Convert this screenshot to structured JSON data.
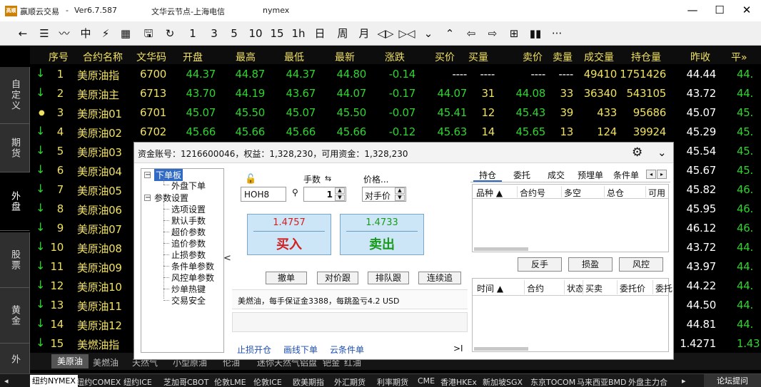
{
  "titlebar": {
    "logo": "高顺",
    "app_name": "赢顺云交易",
    "version": "Ver6.7.587",
    "server": "文华云节点-上海电信",
    "user": "nymex",
    "minimize": "—",
    "maximize": "☐",
    "close": "✕"
  },
  "toolbar": {
    "icons": [
      {
        "name": "back-icon",
        "glyph": "←"
      },
      {
        "name": "list-icon",
        "glyph": "☰"
      },
      {
        "name": "chart-line-icon",
        "glyph": "〰"
      },
      {
        "name": "kline-icon",
        "glyph": "中"
      },
      {
        "name": "flash-icon",
        "glyph": "⚡"
      },
      {
        "name": "grid-icon",
        "glyph": "▦"
      },
      {
        "name": "save-icon",
        "glyph": "🖫"
      },
      {
        "name": "refresh-icon",
        "glyph": "↻"
      },
      {
        "name": "period-1",
        "glyph": "1"
      },
      {
        "name": "period-3",
        "glyph": "3"
      },
      {
        "name": "period-5",
        "glyph": "5"
      },
      {
        "name": "period-10",
        "glyph": "10"
      },
      {
        "name": "period-15",
        "glyph": "15"
      },
      {
        "name": "period-1h",
        "glyph": "1h"
      },
      {
        "name": "period-day",
        "glyph": "日"
      },
      {
        "name": "period-week",
        "glyph": "周"
      },
      {
        "name": "period-month",
        "glyph": "月"
      },
      {
        "name": "zoom-in-icon",
        "glyph": "◁▷"
      },
      {
        "name": "zoom-out-icon",
        "glyph": "▷◁"
      },
      {
        "name": "chevron-down-icon",
        "glyph": "⌄"
      },
      {
        "name": "chevron-up-icon",
        "glyph": "⌃"
      },
      {
        "name": "prev-icon",
        "glyph": "⇦"
      },
      {
        "name": "next-icon",
        "glyph": "⇨"
      },
      {
        "name": "layout-icon",
        "glyph": "⊞"
      },
      {
        "name": "bars-icon",
        "glyph": "▮▮"
      },
      {
        "name": "more-icon",
        "glyph": "···"
      }
    ]
  },
  "sidetabs": [
    {
      "label": "自定义",
      "active": false
    },
    {
      "label": "期货",
      "active": false
    },
    {
      "label": "外盘",
      "active": true
    },
    {
      "label": "股票",
      "active": false
    },
    {
      "label": "黄金",
      "active": false
    },
    {
      "label": "外",
      "active": false
    }
  ],
  "table": {
    "headers": [
      "序号",
      "合约名称",
      "文华码",
      "开盘",
      "最高",
      "最低",
      "最新",
      "涨跌",
      "买价",
      "买量",
      "卖价",
      "卖量",
      "成交量",
      "持仓量",
      "昨收",
      "平均"
    ],
    "header_more": "平»",
    "rows": [
      {
        "trend": "down",
        "no": "1",
        "name": "美原油指",
        "code": "6700",
        "open": "44.37",
        "high": "44.87",
        "low": "44.37",
        "last": "44.80",
        "chg": "-0.14",
        "bid": "----",
        "bidv": "----",
        "ask": "----",
        "askv": "----",
        "vol": "49410",
        "oi": "1751426",
        "prev": "44.44",
        "avg": "44."
      },
      {
        "trend": "down",
        "no": "2",
        "name": "美原油主",
        "code": "6713",
        "open": "43.70",
        "high": "44.19",
        "low": "43.67",
        "last": "44.07",
        "chg": "-0.17",
        "bid": "44.07",
        "bidv": "31",
        "ask": "44.08",
        "askv": "33",
        "vol": "36340",
        "oi": "543105",
        "prev": "43.72",
        "avg": "44."
      },
      {
        "trend": "flat",
        "no": "3",
        "name": "美原油01",
        "code": "6701",
        "open": "45.07",
        "high": "45.50",
        "low": "45.07",
        "last": "45.50",
        "chg": "-0.07",
        "bid": "45.41",
        "bidv": "12",
        "ask": "45.43",
        "askv": "39",
        "vol": "433",
        "oi": "95686",
        "prev": "45.07",
        "avg": "45."
      },
      {
        "trend": "down",
        "no": "4",
        "name": "美原油02",
        "code": "6702",
        "open": "45.66",
        "high": "45.66",
        "low": "45.66",
        "last": "45.66",
        "chg": "-0.12",
        "bid": "45.63",
        "bidv": "14",
        "ask": "45.65",
        "askv": "13",
        "vol": "124",
        "oi": "39924",
        "prev": "45.29",
        "avg": "45."
      },
      {
        "trend": "down",
        "no": "5",
        "name": "美原油03",
        "code": "",
        "open": "",
        "high": "",
        "low": "",
        "last": "",
        "chg": "",
        "bid": "",
        "bidv": "",
        "ask": "",
        "askv": "",
        "vol": "",
        "oi": "",
        "prev": "45.54",
        "avg": "45."
      },
      {
        "trend": "down",
        "no": "6",
        "name": "美原油04",
        "code": "",
        "open": "",
        "high": "",
        "low": "",
        "last": "",
        "chg": "",
        "bid": "",
        "bidv": "",
        "ask": "",
        "askv": "",
        "vol": "",
        "oi": "",
        "prev": "45.67",
        "avg": "45."
      },
      {
        "trend": "down",
        "no": "7",
        "name": "美原油05",
        "code": "",
        "open": "",
        "high": "",
        "low": "",
        "last": "",
        "chg": "",
        "bid": "",
        "bidv": "",
        "ask": "",
        "askv": "",
        "vol": "",
        "oi": "",
        "prev": "45.82",
        "avg": "46."
      },
      {
        "trend": "down",
        "no": "8",
        "name": "美原油06",
        "code": "",
        "open": "",
        "high": "",
        "low": "",
        "last": "",
        "chg": "",
        "bid": "",
        "bidv": "",
        "ask": "",
        "askv": "",
        "vol": "",
        "oi": "",
        "prev": "45.95",
        "avg": "46."
      },
      {
        "trend": "down",
        "no": "9",
        "name": "美原油07",
        "code": "",
        "open": "",
        "high": "",
        "low": "",
        "last": "",
        "chg": "",
        "bid": "",
        "bidv": "",
        "ask": "",
        "askv": "",
        "vol": "",
        "oi": "",
        "prev": "46.12",
        "avg": "46."
      },
      {
        "trend": "down",
        "no": "10",
        "name": "美原油08",
        "code": "",
        "open": "",
        "high": "",
        "low": "",
        "last": "",
        "chg": "",
        "bid": "",
        "bidv": "",
        "ask": "",
        "askv": "",
        "vol": "",
        "oi": "",
        "prev": "43.72",
        "avg": "44."
      },
      {
        "trend": "down",
        "no": "11",
        "name": "美原油09",
        "code": "",
        "open": "",
        "high": "",
        "low": "",
        "last": "",
        "chg": "",
        "bid": "",
        "bidv": "",
        "ask": "",
        "askv": "",
        "vol": "",
        "oi": "",
        "prev": "43.97",
        "avg": "44."
      },
      {
        "trend": "down",
        "no": "12",
        "name": "美原油10",
        "code": "",
        "open": "",
        "high": "",
        "low": "",
        "last": "",
        "chg": "",
        "bid": "",
        "bidv": "",
        "ask": "",
        "askv": "",
        "vol": "",
        "oi": "",
        "prev": "44.22",
        "avg": "44."
      },
      {
        "trend": "down",
        "no": "13",
        "name": "美原油11",
        "code": "",
        "open": "",
        "high": "",
        "low": "",
        "last": "",
        "chg": "",
        "bid": "",
        "bidv": "",
        "ask": "",
        "askv": "",
        "vol": "",
        "oi": "",
        "prev": "44.50",
        "avg": "44."
      },
      {
        "trend": "down",
        "no": "14",
        "name": "美原油12",
        "code": "",
        "open": "",
        "high": "",
        "low": "",
        "last": "",
        "chg": "",
        "bid": "",
        "bidv": "",
        "ask": "",
        "askv": "",
        "vol": "",
        "oi": "",
        "prev": "44.81",
        "avg": "44."
      },
      {
        "trend": "down",
        "no": "15",
        "name": "美燃油指",
        "code": "",
        "open": "",
        "high": "",
        "low": "",
        "last": "",
        "chg": "",
        "bid": "",
        "bidv": "",
        "ask": "",
        "askv": "",
        "vol": "",
        "oi": "",
        "prev": "1.4271",
        "avg": "1.43"
      }
    ]
  },
  "subtabs": [
    "美原油",
    "美燃油",
    "天然气",
    "小型原油",
    "伦油",
    "迷你天然气",
    "铝盘",
    "钯金",
    "红油"
  ],
  "bottombar": {
    "items": [
      "纽约NYMEX",
      "纽约COMEX",
      "纽约ICE",
      "芝加哥CBOT",
      "伦敦LME",
      "伦敦ICE",
      "欧美期指",
      "外汇期货",
      "利率期货",
      "CME",
      "香港HKEx",
      "新加坡SGX",
      "东京TOCOM",
      "马来西亚BMD",
      "外盘主力合"
    ],
    "more_arrow": "▸",
    "forum": "论坛提问",
    "left_arrow": "◂"
  },
  "dialog": {
    "account_text": "资金账号：1216600046，权益：1,328,230，可用资金：1,328,230",
    "tree": {
      "order_root": "下单板",
      "order_child": "外盘下单",
      "settings_root": "参数设置",
      "settings_children": [
        "选项设置",
        "默认手数",
        "超价参数",
        "追价参数",
        "止损参数",
        "条件单参数",
        "风控单参数",
        "炒单热键",
        "交易安全"
      ]
    },
    "order": {
      "qty_label": "手数",
      "price_label": "价格...",
      "contract": "HOH8",
      "qty": "1",
      "price_mode": "对手价",
      "buy_price": "1.4757",
      "buy_label": "买入",
      "sell_price": "1.4733",
      "sell_label": "卖出",
      "cancel": "撤单",
      "chase_price": "对价跟",
      "queue_follow": "排队跟",
      "continuous": "连续追",
      "info": "美燃油，每手保证金3388，每跳盈亏4.2 USD"
    },
    "links": [
      "止损开仓",
      "画线下单",
      "云条件单"
    ],
    "link_more": ">I",
    "right": {
      "tabs": [
        "持仓",
        "委托",
        "成交",
        "预埋单",
        "条件单"
      ],
      "pos_headers": [
        "品种 ▲",
        "合约号",
        "多空",
        "总仓",
        "可用"
      ],
      "buttons": [
        "反手",
        "损盈",
        "风控"
      ],
      "order_headers": [
        "时间 ▲",
        "合约",
        "状态",
        "买卖",
        "委托价",
        "委托"
      ]
    }
  },
  "colors": {
    "up": "#ff3434",
    "down": "#2fd42f",
    "header": "#f0e060",
    "buy": "#d02020",
    "sell": "#1a9a1a"
  }
}
